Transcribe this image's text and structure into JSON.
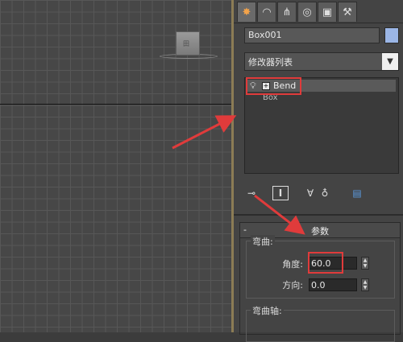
{
  "object": {
    "name": "Box001",
    "color": "#9bb6e6"
  },
  "viewport": {
    "box_label": "田"
  },
  "modifier_list": {
    "label": "修改器列表"
  },
  "stack": {
    "items": [
      {
        "label": "Bend"
      },
      {
        "label": "Box"
      }
    ]
  },
  "parameters": {
    "title": "参数",
    "collapse": "-",
    "bend_group": "弯曲:",
    "angle_label": "角度:",
    "angle_value": "60.0",
    "direction_label": "方向:",
    "direction_value": "0.0",
    "axis_group": "弯曲轴:"
  },
  "icons": {
    "tabs": [
      "create-icon",
      "modify-icon",
      "hierarchy-icon",
      "motion-icon",
      "display-icon",
      "utilities-icon"
    ]
  },
  "annotation_color": "#e03b3b"
}
